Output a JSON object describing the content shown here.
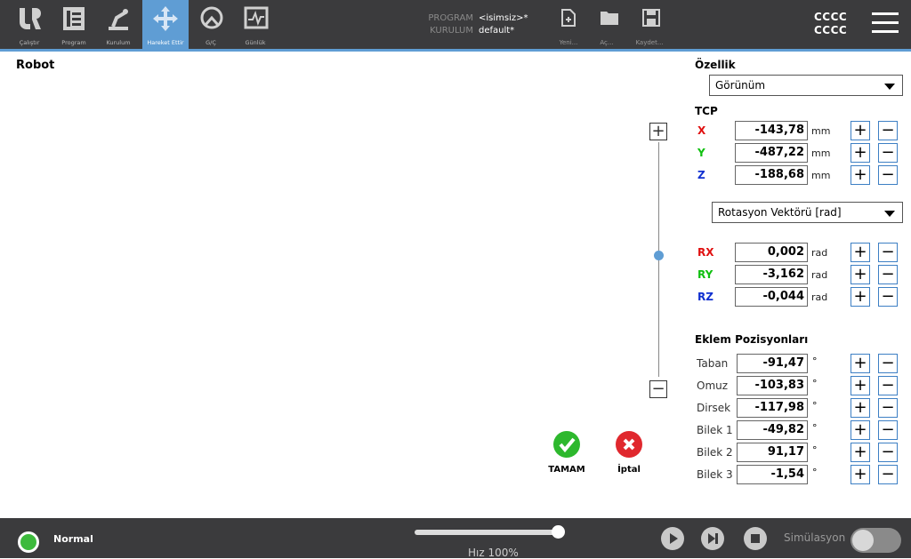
{
  "nav": {
    "items": [
      {
        "label": "Çalıştır",
        "icon": "ur-logo-icon"
      },
      {
        "label": "Program",
        "icon": "program-icon"
      },
      {
        "label": "Kurulum",
        "icon": "robot-arm-icon"
      },
      {
        "label": "Hareket Ettir",
        "icon": "move-arrows-icon",
        "active": true
      },
      {
        "label": "G/Ç",
        "icon": "io-icon"
      },
      {
        "label": "Günlük",
        "icon": "log-icon"
      }
    ]
  },
  "program": {
    "program_key": "PROGRAM",
    "program_value": "<isimsiz>*",
    "install_key": "KURULUM",
    "install_value": "default*"
  },
  "file": {
    "new_label": "Yeni...",
    "open_label": "Aç...",
    "save_label": "Kaydet..."
  },
  "user": {
    "line1": "CCCC",
    "line2": "CCCC"
  },
  "main": {
    "robot_title": "Robot"
  },
  "feature": {
    "title": "Özellik",
    "selected": "Görünüm"
  },
  "tcp": {
    "title": "TCP",
    "x": {
      "label": "X",
      "value": "-143,78",
      "unit": "mm"
    },
    "y": {
      "label": "Y",
      "value": "-487,22",
      "unit": "mm"
    },
    "z": {
      "label": "Z",
      "value": "-188,68",
      "unit": "mm"
    },
    "rotation_mode": "Rotasyon Vektörü [rad]",
    "rx": {
      "label": "RX",
      "value": "0,002",
      "unit": "rad"
    },
    "ry": {
      "label": "RY",
      "value": "-3,162",
      "unit": "rad"
    },
    "rz": {
      "label": "RZ",
      "value": "-0,044",
      "unit": "rad"
    }
  },
  "joints": {
    "title": "Eklem Pozisyonları",
    "unit": "°",
    "items": [
      {
        "label": "Taban",
        "value": "-91,47"
      },
      {
        "label": "Omuz",
        "value": "-103,83"
      },
      {
        "label": "Dirsek",
        "value": "-117,98"
      },
      {
        "label": "Bilek 1",
        "value": "-49,82"
      },
      {
        "label": "Bilek 2",
        "value": "91,17"
      },
      {
        "label": "Bilek 3",
        "value": "-1,54"
      }
    ]
  },
  "actions": {
    "ok_label": "TAMAM",
    "cancel_label": "İptal"
  },
  "status": {
    "label": "Normal",
    "color": "#3cba3c"
  },
  "speed": {
    "label": "Hız 100%",
    "value_percent": 100
  },
  "simulation": {
    "label": "Simülasyon",
    "enabled": false
  },
  "colors": {
    "x_axis": "#e01010",
    "y_axis": "#10c010",
    "z_axis": "#1030d0",
    "accent": "#5f9dd4",
    "ok": "#2db82d",
    "cancel": "#e0282e"
  },
  "symbols": {
    "plus": "+",
    "minus": "−"
  }
}
